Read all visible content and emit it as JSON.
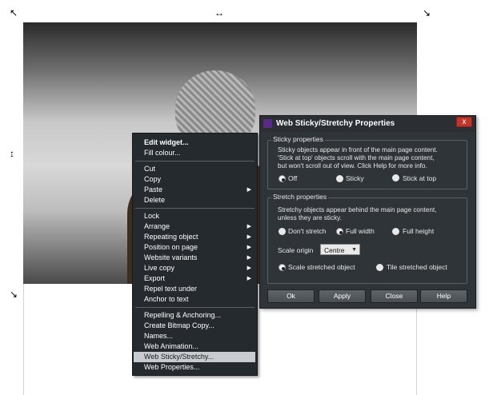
{
  "context_menu": {
    "items": [
      {
        "label": "Edit widget...",
        "bold": true
      },
      {
        "label": "Fill colour..."
      },
      {
        "label": "Cut"
      },
      {
        "label": "Copy"
      },
      {
        "label": "Paste",
        "submenu": true
      },
      {
        "label": "Delete"
      },
      {
        "label": "Lock"
      },
      {
        "label": "Arrange",
        "submenu": true
      },
      {
        "label": "Repeating object",
        "submenu": true
      },
      {
        "label": "Position on page",
        "submenu": true
      },
      {
        "label": "Website variants",
        "submenu": true
      },
      {
        "label": "Live copy",
        "submenu": true
      },
      {
        "label": "Export",
        "submenu": true
      },
      {
        "label": "Repel text under"
      },
      {
        "label": "Anchor to text"
      },
      {
        "label": "Repelling & Anchoring..."
      },
      {
        "label": "Create Bitmap Copy..."
      },
      {
        "label": "Names..."
      },
      {
        "label": "Web Animation..."
      },
      {
        "label": "Web Sticky/Stretchy...",
        "selected": true
      },
      {
        "label": "Web Properties..."
      }
    ]
  },
  "dialog": {
    "title": "Web Sticky/Stretchy Properties",
    "close_label": "x",
    "sticky": {
      "heading": "Sticky properties",
      "description": [
        "Sticky objects appear in front of the main page content.",
        "'Stick at top' objects scroll with the main page content,",
        "but won't scroll out of view. Click Help for more info."
      ],
      "options": [
        "Off",
        "Sticky",
        "Stick at top"
      ],
      "selected": "Off"
    },
    "stretch": {
      "heading": "Stretch properties",
      "description": [
        "Stretchy objects appear behind the main page content,",
        "unless they are sticky."
      ],
      "options": [
        "Don't stretch",
        "Full width",
        "Full height"
      ],
      "selected": "Full width",
      "scale_origin_label": "Scale origin",
      "scale_origin_value": "Centre",
      "scale_options": [
        "Scale stretched object",
        "Tile stretched object"
      ],
      "scale_selected": "Scale stretched object"
    },
    "buttons": {
      "ok": "Ok",
      "apply": "Apply",
      "close": "Close",
      "help": "Help"
    }
  }
}
